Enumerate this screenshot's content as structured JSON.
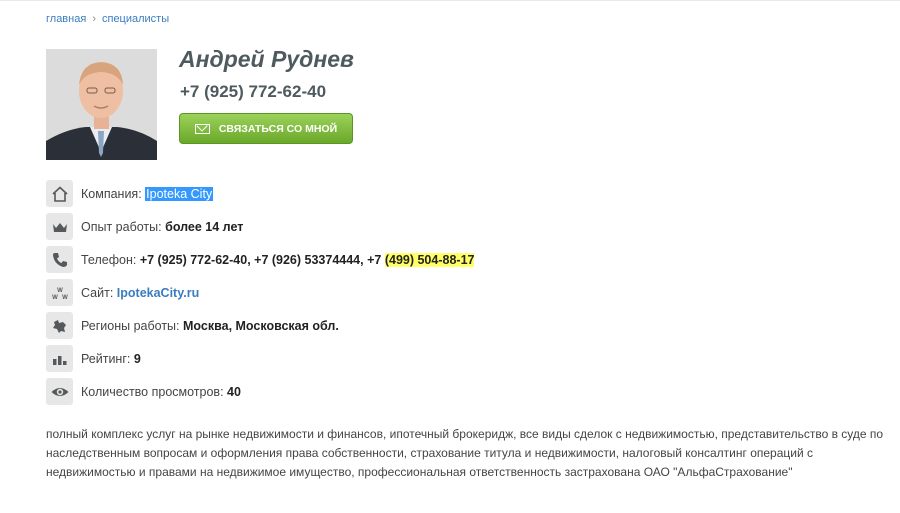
{
  "breadcrumb": {
    "home": "главная",
    "separator": "›",
    "section": "специалисты"
  },
  "profile": {
    "name": "Андрей Руднев",
    "phone": "+7 (925) 772-62-40",
    "contact_button": "СВЯЗАТЬСЯ СО МНОЙ"
  },
  "info": {
    "company_label": "Компания:",
    "company_value": "Ipoteka City",
    "experience_label": "Опыт работы:",
    "experience_value": "более 14 лет",
    "phone_label": "Телефон:",
    "phone_value_main": "+7 (925) 772-62-40, +7 (926) 53374444, +7",
    "phone_value_highlight": "(499) 504-88-17",
    "site_label": "Сайт:",
    "site_value": "IpotekaCity.ru",
    "regions_label": "Регионы работы:",
    "regions_value": "Москва, Московская обл.",
    "rating_label": "Рейтинг:",
    "rating_value": "9",
    "views_label": "Количество просмотров:",
    "views_value": "40"
  },
  "description": "полный комплекс услуг на рынке недвижимости и финансов, ипотечный брокеридж, все виды сделок с недвижимостью, представительство в суде по наследственным вопросам и оформления права собственности, страхование титула и недвижимости, налоговый консалтинг операций с недвижимостью и правами на недвижимое имущество, профессиональная ответственность застрахована ОАО \"АльфаСтрахование\"",
  "icons": [
    "home-icon",
    "crown-icon",
    "phone-icon",
    "www-icon",
    "region-map-icon",
    "rating-bars-icon",
    "eye-icon"
  ],
  "colors": {
    "link": "#3a7dbf",
    "button": "#7bbf36",
    "name": "#4e5a5e",
    "highlight": "#ffff66",
    "selection": "#3399ff"
  }
}
